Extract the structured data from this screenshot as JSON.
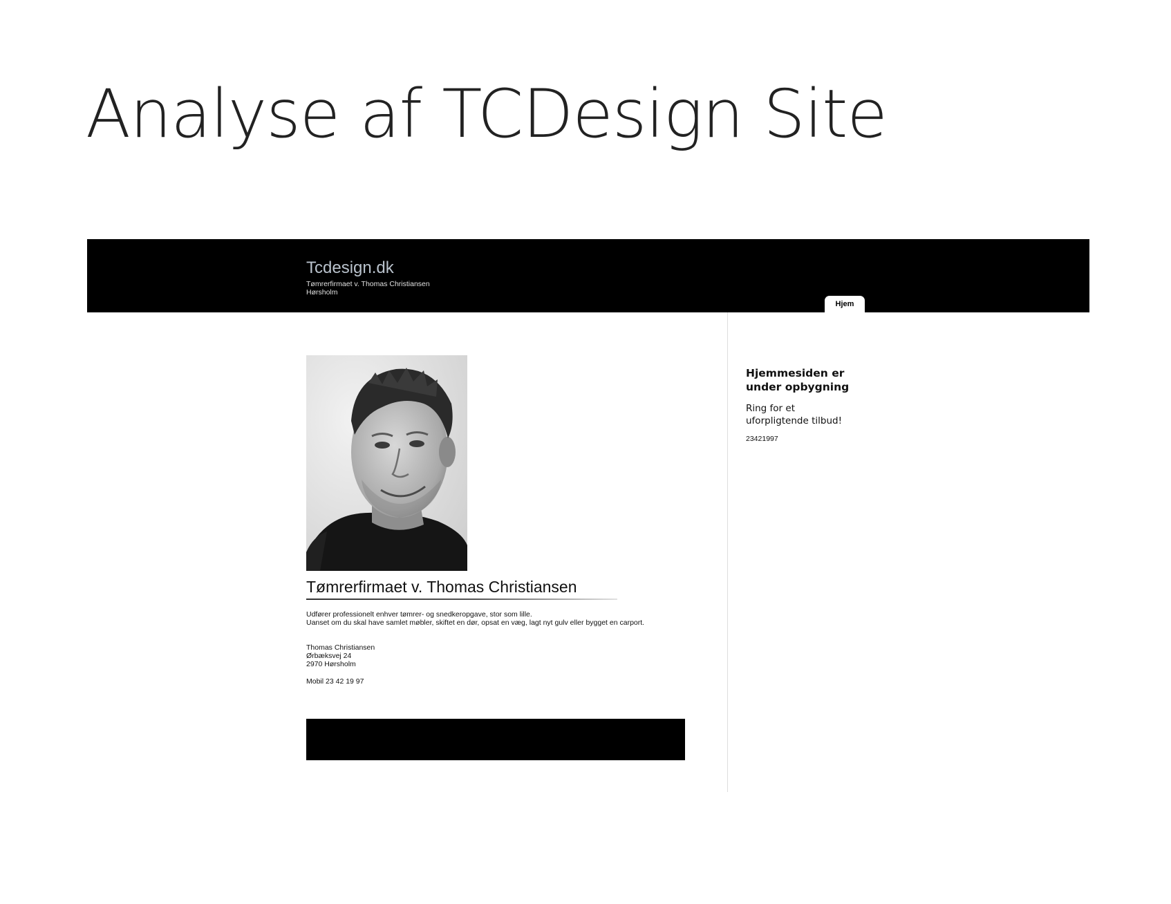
{
  "slide": {
    "title": "Analyse af TCDesign Site"
  },
  "site": {
    "header": {
      "name": "Tcdesign.dk",
      "tagline": "Tømrerfirmaet v. Thomas Christiansen",
      "city": "Hørsholm"
    },
    "nav": {
      "home_label": "Hjem"
    },
    "main": {
      "heading": "Tømrerfirmaet v. Thomas Christiansen",
      "intro_line1": "Udfører professionelt enhver tømrer- og snedkeropgave, stor som lille.",
      "intro_line2": "Uanset om du skal have samlet møbler, skiftet en dør, opsat en væg, lagt nyt gulv eller bygget en carport.",
      "contact_name": "Thomas Christiansen",
      "contact_street": "Ørbæksvej 24",
      "contact_city": "2970 Hørsholm",
      "contact_mobile": "Mobil 23 42 19 97"
    },
    "sidebar": {
      "heading": "Hjemmesiden er under opbygning",
      "text": "Ring for et uforpligtende tilbud!",
      "phone": "23421997"
    },
    "colors": {
      "header_bg": "#000000",
      "site_name": "#b9c2cc",
      "footer_bg": "#000000"
    },
    "icons": {
      "portrait": "person-photo"
    }
  }
}
